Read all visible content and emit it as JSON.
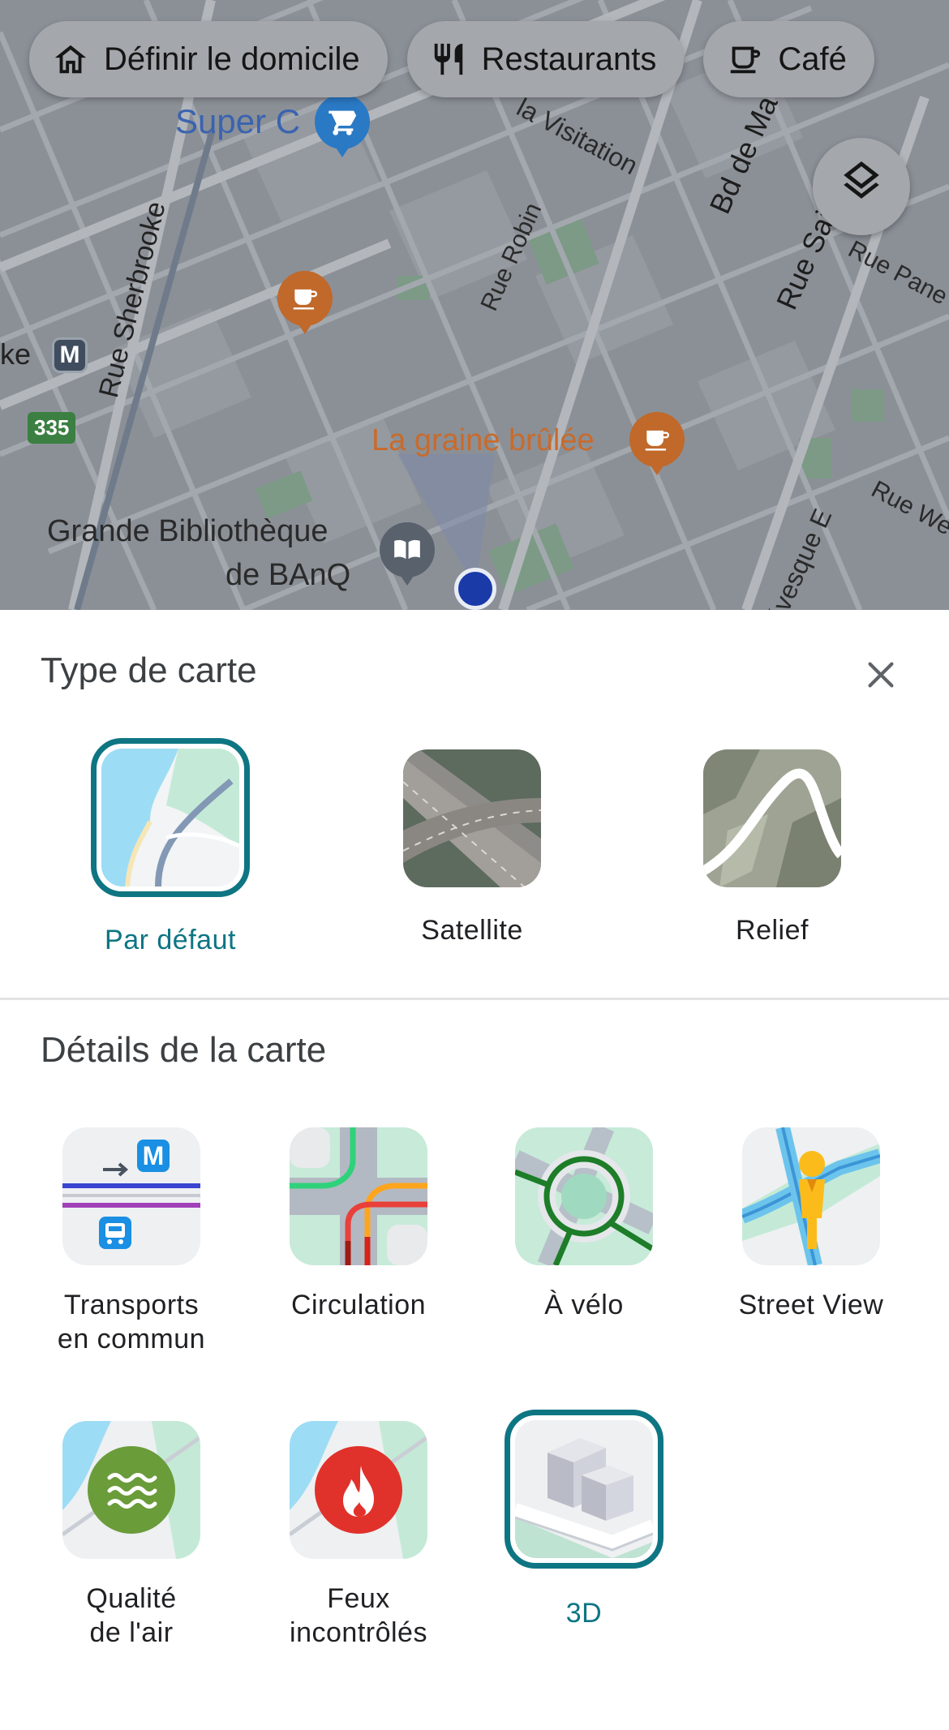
{
  "map": {
    "chips": [
      {
        "label": "Définir le domicile",
        "icon": "home-icon"
      },
      {
        "label": "Restaurants",
        "icon": "fork-knife-icon"
      },
      {
        "label": "Café",
        "icon": "coffee-cup-icon"
      }
    ],
    "layers_icon": "layers-icon",
    "labels": {
      "super_c": "Super C",
      "rue_sherbrooke": "Rue Sherbrooke",
      "rue_robin": "Rue Robin",
      "la_visitation": "la Visitation",
      "bd_de_ma": "Bd de Ma",
      "rue_sai": "Rue Sai",
      "rue_pane": "Rue Pane",
      "rue_we": "Rue We",
      "evesque_e": "évesque E",
      "la_graine_brulee": "La graine brûlée",
      "grande_bibliotheque_1": "Grande Bibliothèque",
      "grande_bibliotheque_2": "de BAnQ",
      "ke": "ke",
      "metro": "M",
      "highway": "335"
    }
  },
  "sheet": {
    "title": "Type de carte",
    "close_icon": "close-icon",
    "map_types": [
      {
        "label": "Par défaut",
        "selected": true
      },
      {
        "label": "Satellite",
        "selected": false
      },
      {
        "label": "Relief",
        "selected": false
      }
    ],
    "details_title": "Détails de la carte",
    "details": [
      {
        "line1": "Transports",
        "line2": "en commun",
        "selected": false
      },
      {
        "line1": "Circulation",
        "line2": "",
        "selected": false
      },
      {
        "line1": "À vélo",
        "line2": "",
        "selected": false
      },
      {
        "line1": "Street View",
        "line2": "",
        "selected": false
      },
      {
        "line1": "Qualité",
        "line2": "de l'air",
        "selected": false
      },
      {
        "line1": "Feux",
        "line2": "incontrôlés",
        "selected": false
      },
      {
        "line1": "3D",
        "line2": "",
        "selected": true
      }
    ]
  },
  "colors": {
    "accent": "#0e7583",
    "map_overlay": "#8a8f96",
    "poi_orange": "#c0692a",
    "poi_blue": "#2a79c4"
  }
}
